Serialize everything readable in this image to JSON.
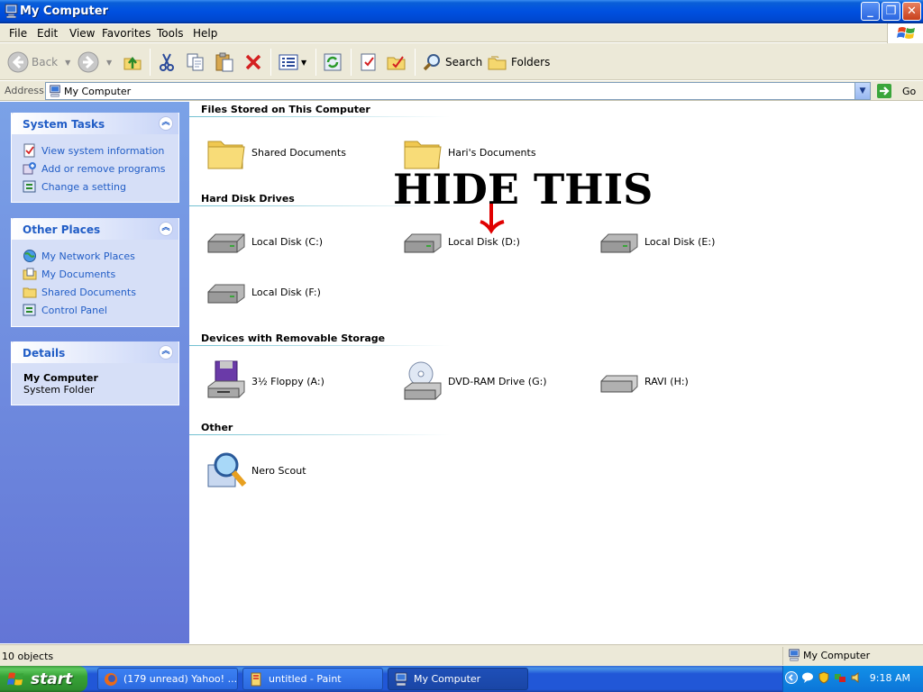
{
  "window": {
    "title": "My Computer"
  },
  "menu": [
    "File",
    "Edit",
    "View",
    "Favorites",
    "Tools",
    "Help"
  ],
  "toolbar": {
    "back": "Back",
    "search": "Search",
    "folders": "Folders"
  },
  "address": {
    "label": "Address",
    "value": "My Computer",
    "go": "Go"
  },
  "sidebar": {
    "system_tasks": {
      "title": "System Tasks",
      "items": [
        "View system information",
        "Add or remove programs",
        "Change a setting"
      ]
    },
    "other_places": {
      "title": "Other Places",
      "items": [
        "My Network Places",
        "My Documents",
        "Shared Documents",
        "Control Panel"
      ]
    },
    "details": {
      "title": "Details",
      "name": "My Computer",
      "type": "System Folder"
    }
  },
  "groups": {
    "files": {
      "title": "Files Stored on This Computer",
      "items": [
        "Shared Documents",
        "Hari's Documents"
      ]
    },
    "hdd": {
      "title": "Hard Disk Drives",
      "items": [
        "Local Disk (C:)",
        "Local Disk (D:)",
        "Local Disk (E:)",
        "Local Disk (F:)"
      ]
    },
    "removable": {
      "title": "Devices with Removable Storage",
      "items": [
        "3½ Floppy (A:)",
        "DVD-RAM Drive (G:)",
        "RAVI (H:)"
      ]
    },
    "other": {
      "title": "Other",
      "items": [
        "Nero Scout"
      ]
    }
  },
  "annotation": {
    "text": "HIDE THIS",
    "arrow_color": "#e00000"
  },
  "status": {
    "count": "10 objects",
    "location": "My Computer"
  },
  "taskbar": {
    "start": "start",
    "tasks": [
      "(179 unread) Yahoo! ...",
      "untitled - Paint",
      "My Computer"
    ],
    "clock": "9:18 AM"
  },
  "colors": {
    "link": "#215dc6",
    "sidebar_top": "#7ba2e7",
    "sidebar_bottom": "#6375d6",
    "titlebar": "#0050e0"
  }
}
